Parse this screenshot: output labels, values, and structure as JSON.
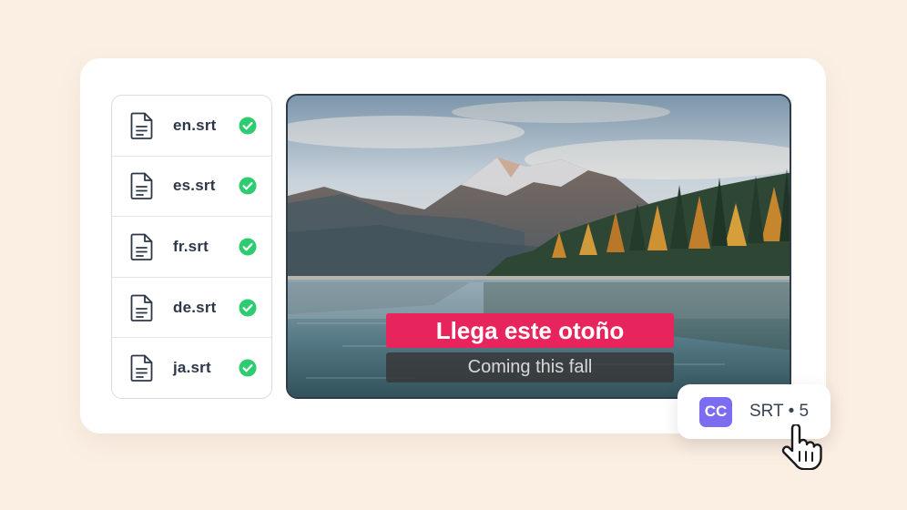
{
  "files": [
    {
      "name": "en.srt",
      "status": "done"
    },
    {
      "name": "es.srt",
      "status": "done"
    },
    {
      "name": "fr.srt",
      "status": "done"
    },
    {
      "name": "de.srt",
      "status": "done"
    },
    {
      "name": "ja.srt",
      "status": "done"
    }
  ],
  "player": {
    "subtitle_primary": "Llega este otoño",
    "subtitle_secondary": "Coming this fall"
  },
  "cc_pill": {
    "badge": "CC",
    "label": "SRT • 5"
  },
  "colors": {
    "background": "#fbefe3",
    "check": "#2ecc71",
    "subtitle_primary_bg": "#e8245c",
    "cc_badge": "#7b6cf0"
  },
  "icons": [
    "document-icon",
    "check-circle-icon",
    "pointer-hand-icon"
  ]
}
